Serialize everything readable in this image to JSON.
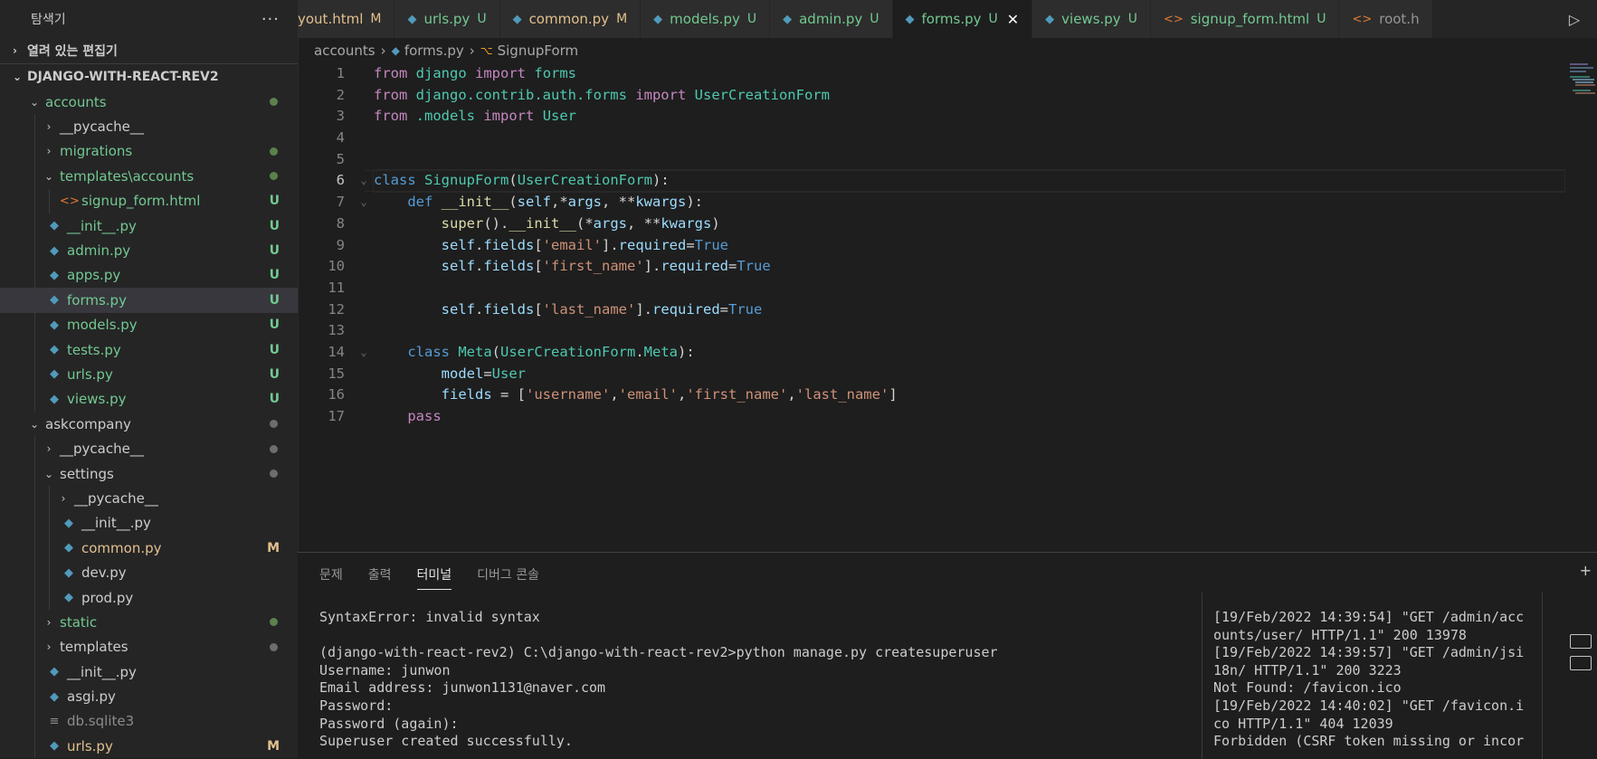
{
  "explorer": {
    "title": "탐색기",
    "more": "···",
    "open_editors": "열려 있는 편집기",
    "project": "DJANGO-WITH-REACT-REV2",
    "items": [
      {
        "label": "accounts",
        "type": "folder",
        "open": true,
        "depth": 1,
        "status": "dot-green"
      },
      {
        "label": "__pycache__",
        "type": "folder",
        "open": false,
        "depth": 2,
        "status": ""
      },
      {
        "label": "migrations",
        "type": "folder",
        "open": false,
        "depth": 2,
        "status": "dot-green"
      },
      {
        "label": "templates\\accounts",
        "type": "folder",
        "open": true,
        "depth": 2,
        "status": "dot-green"
      },
      {
        "label": "signup_form.html",
        "type": "html",
        "depth": 3,
        "status": "U"
      },
      {
        "label": "__init__.py",
        "type": "py",
        "depth": 2,
        "status": "U"
      },
      {
        "label": "admin.py",
        "type": "py",
        "depth": 2,
        "status": "U"
      },
      {
        "label": "apps.py",
        "type": "py",
        "depth": 2,
        "status": "U"
      },
      {
        "label": "forms.py",
        "type": "py",
        "depth": 2,
        "status": "U",
        "selected": true
      },
      {
        "label": "models.py",
        "type": "py",
        "depth": 2,
        "status": "U"
      },
      {
        "label": "tests.py",
        "type": "py",
        "depth": 2,
        "status": "U"
      },
      {
        "label": "urls.py",
        "type": "py",
        "depth": 2,
        "status": "U"
      },
      {
        "label": "views.py",
        "type": "py",
        "depth": 2,
        "status": "U"
      },
      {
        "label": "askcompany",
        "type": "folder",
        "open": true,
        "depth": 1,
        "status": "dot-gray"
      },
      {
        "label": "__pycache__",
        "type": "folder",
        "open": false,
        "depth": 2,
        "status": "dot-gray"
      },
      {
        "label": "settings",
        "type": "folder",
        "open": true,
        "depth": 2,
        "status": "dot-gray"
      },
      {
        "label": "__pycache__",
        "type": "folder",
        "open": false,
        "depth": 3,
        "status": ""
      },
      {
        "label": "__init__.py",
        "type": "py",
        "depth": 3,
        "status": ""
      },
      {
        "label": "common.py",
        "type": "py",
        "depth": 3,
        "status": "M"
      },
      {
        "label": "dev.py",
        "type": "py",
        "depth": 3,
        "status": ""
      },
      {
        "label": "prod.py",
        "type": "py",
        "depth": 3,
        "status": ""
      },
      {
        "label": "static",
        "type": "folder",
        "open": false,
        "depth": 2,
        "status": "dot-green"
      },
      {
        "label": "templates",
        "type": "folder",
        "open": false,
        "depth": 2,
        "status": "dot-gray"
      },
      {
        "label": "__init__.py",
        "type": "py",
        "depth": 2,
        "status": ""
      },
      {
        "label": "asgi.py",
        "type": "py",
        "depth": 2,
        "status": ""
      },
      {
        "label": "db.sqlite3",
        "type": "db",
        "depth": 2,
        "status": ""
      },
      {
        "label": "urls.py",
        "type": "py",
        "depth": 2,
        "status": "M"
      }
    ]
  },
  "tabs": [
    {
      "label": "yout.html",
      "icon": "html",
      "status": "M"
    },
    {
      "label": "urls.py",
      "icon": "py",
      "status": "U"
    },
    {
      "label": "common.py",
      "icon": "py",
      "status": "M"
    },
    {
      "label": "models.py",
      "icon": "py",
      "status": "U"
    },
    {
      "label": "admin.py",
      "icon": "py",
      "status": "U"
    },
    {
      "label": "forms.py",
      "icon": "py",
      "status": "U",
      "active": true
    },
    {
      "label": "views.py",
      "icon": "py",
      "status": "U"
    },
    {
      "label": "signup_form.html",
      "icon": "html",
      "status": "U"
    },
    {
      "label": "root.h",
      "icon": "html",
      "status": ""
    }
  ],
  "close_glyph": "✕",
  "run_glyph": "▷",
  "breadcrumb": {
    "folder": "accounts",
    "file": "forms.py",
    "symbol": "SignupForm"
  },
  "code_lines": [
    [
      [
        "kw",
        "from"
      ],
      [
        "t",
        " "
      ],
      [
        "cls",
        "django"
      ],
      [
        "t",
        " "
      ],
      [
        "kw",
        "import"
      ],
      [
        "t",
        " "
      ],
      [
        "cls",
        "forms"
      ]
    ],
    [
      [
        "kw",
        "from"
      ],
      [
        "t",
        " "
      ],
      [
        "cls",
        "django.contrib.auth.forms"
      ],
      [
        "t",
        " "
      ],
      [
        "kw",
        "import"
      ],
      [
        "t",
        " "
      ],
      [
        "cls",
        "UserCreationForm"
      ]
    ],
    [
      [
        "kw",
        "from"
      ],
      [
        "t",
        " "
      ],
      [
        "cls",
        ".models"
      ],
      [
        "t",
        " "
      ],
      [
        "kw",
        "import"
      ],
      [
        "t",
        " "
      ],
      [
        "cls",
        "User"
      ]
    ],
    [],
    [],
    [
      [
        "kw2",
        "class"
      ],
      [
        "t",
        " "
      ],
      [
        "cls",
        "SignupForm"
      ],
      [
        "t",
        "("
      ],
      [
        "cls",
        "UserCreationForm"
      ],
      [
        "t",
        "):"
      ]
    ],
    [
      [
        "t",
        "    "
      ],
      [
        "kw2",
        "def"
      ],
      [
        "t",
        " "
      ],
      [
        "fn",
        "__init__"
      ],
      [
        "t",
        "("
      ],
      [
        "var",
        "self"
      ],
      [
        "t",
        ",*"
      ],
      [
        "var",
        "args"
      ],
      [
        "t",
        ", **"
      ],
      [
        "var",
        "kwargs"
      ],
      [
        "t",
        "):"
      ]
    ],
    [
      [
        "t",
        "        "
      ],
      [
        "fn",
        "super"
      ],
      [
        "t",
        "()."
      ],
      [
        "fn",
        "__init__"
      ],
      [
        "t",
        "(*"
      ],
      [
        "var",
        "args"
      ],
      [
        "t",
        ", **"
      ],
      [
        "var",
        "kwargs"
      ],
      [
        "t",
        ")"
      ]
    ],
    [
      [
        "t",
        "        "
      ],
      [
        "var",
        "self"
      ],
      [
        "t",
        "."
      ],
      [
        "var",
        "fields"
      ],
      [
        "t",
        "["
      ],
      [
        "str",
        "'email'"
      ],
      [
        "t",
        "]."
      ],
      [
        "var",
        "required"
      ],
      [
        "t",
        "="
      ],
      [
        "kw2",
        "True"
      ]
    ],
    [
      [
        "t",
        "        "
      ],
      [
        "var",
        "self"
      ],
      [
        "t",
        "."
      ],
      [
        "var",
        "fields"
      ],
      [
        "t",
        "["
      ],
      [
        "str",
        "'first_name'"
      ],
      [
        "t",
        "]."
      ],
      [
        "var",
        "required"
      ],
      [
        "t",
        "="
      ],
      [
        "kw2",
        "True"
      ]
    ],
    [],
    [
      [
        "t",
        "        "
      ],
      [
        "var",
        "self"
      ],
      [
        "t",
        "."
      ],
      [
        "var",
        "fields"
      ],
      [
        "t",
        "["
      ],
      [
        "str",
        "'last_name'"
      ],
      [
        "t",
        "]."
      ],
      [
        "var",
        "required"
      ],
      [
        "t",
        "="
      ],
      [
        "kw2",
        "True"
      ]
    ],
    [],
    [
      [
        "t",
        "    "
      ],
      [
        "kw2",
        "class"
      ],
      [
        "t",
        " "
      ],
      [
        "cls",
        "Meta"
      ],
      [
        "t",
        "("
      ],
      [
        "cls",
        "UserCreationForm"
      ],
      [
        "t",
        "."
      ],
      [
        "cls",
        "Meta"
      ],
      [
        "t",
        "):"
      ]
    ],
    [
      [
        "t",
        "        "
      ],
      [
        "var",
        "model"
      ],
      [
        "t",
        "="
      ],
      [
        "cls",
        "User"
      ]
    ],
    [
      [
        "t",
        "        "
      ],
      [
        "var",
        "fields"
      ],
      [
        "t",
        " = ["
      ],
      [
        "str",
        "'username'"
      ],
      [
        "t",
        ","
      ],
      [
        "str",
        "'email'"
      ],
      [
        "t",
        ","
      ],
      [
        "str",
        "'first_name'"
      ],
      [
        "t",
        ","
      ],
      [
        "str",
        "'last_name'"
      ],
      [
        "t",
        "]"
      ]
    ],
    [
      [
        "t",
        "    "
      ],
      [
        "kw",
        "pass"
      ]
    ]
  ],
  "panel": {
    "tabs": [
      "문제",
      "출력",
      "터미널",
      "디버그 콘솔"
    ],
    "active_tab": "터미널",
    "plus": "+",
    "terminal_lines": [
      "SyntaxError: invalid syntax",
      "",
      "(django-with-react-rev2) C:\\django-with-react-rev2>python manage.py createsuperuser",
      "Username: junwon",
      "Email address: junwon1131@naver.com",
      "Password:",
      "Password (again):",
      "Superuser created successfully."
    ],
    "log_lines": [
      "[19/Feb/2022 14:39:54] \"GET /admin/acc",
      "ounts/user/ HTTP/1.1\" 200 13978",
      "[19/Feb/2022 14:39:57] \"GET /admin/jsi",
      "18n/ HTTP/1.1\" 200 3223",
      "Not Found: /favicon.ico",
      "[19/Feb/2022 14:40:02] \"GET /favicon.i",
      "co HTTP/1.1\" 404 12039",
      "Forbidden (CSRF token missing or incor"
    ]
  }
}
